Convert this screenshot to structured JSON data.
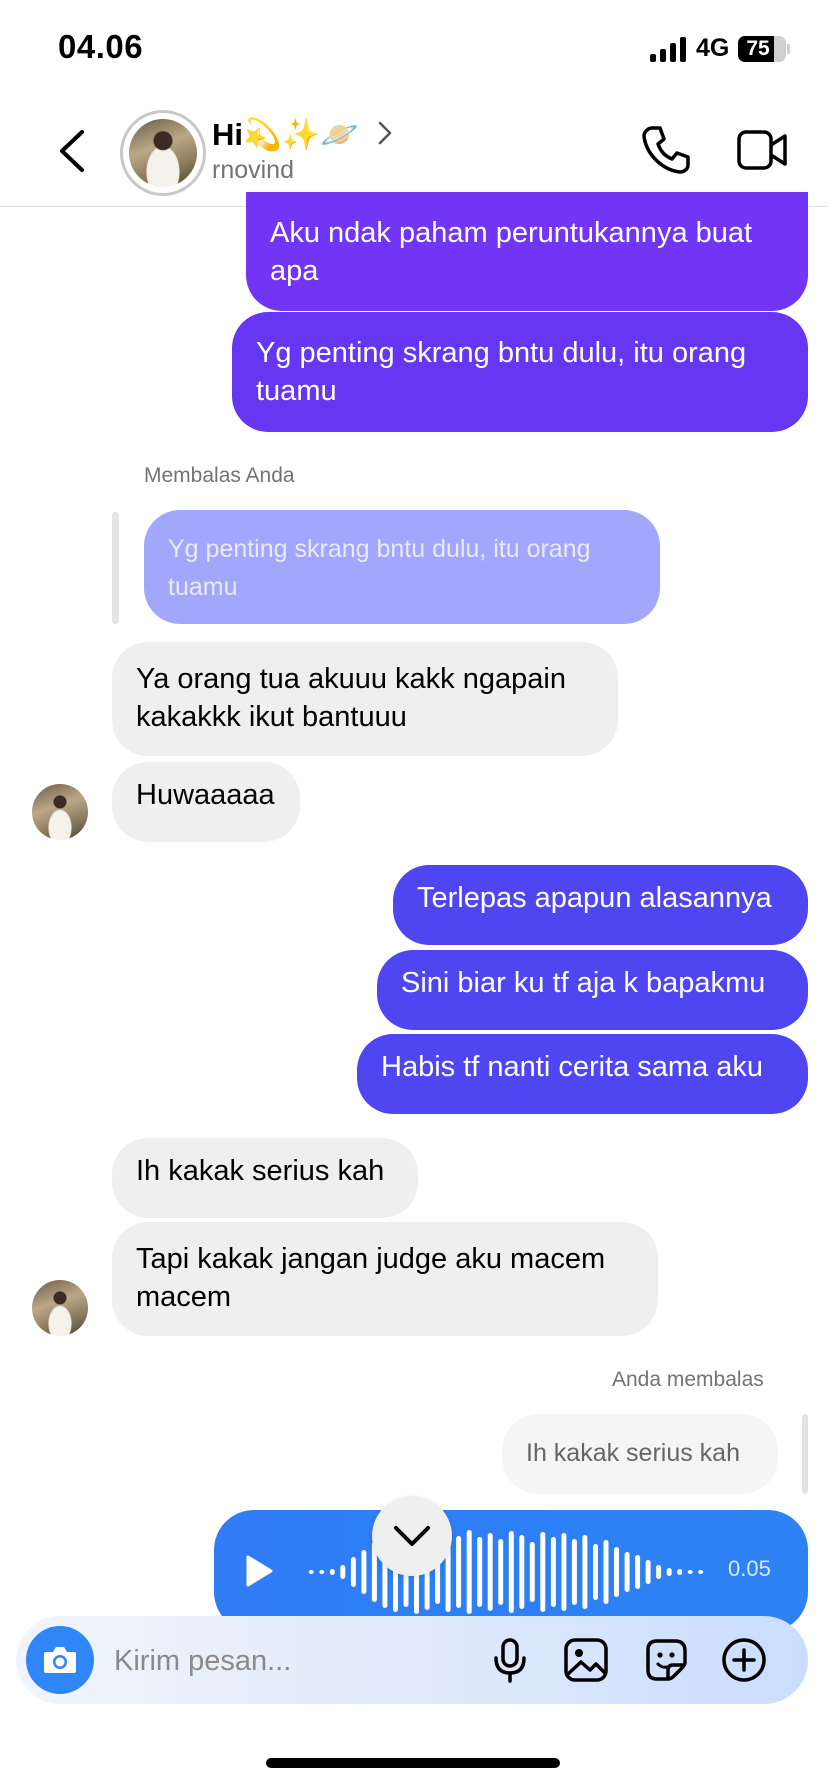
{
  "status_bar": {
    "time": "04.06",
    "network": "4G",
    "battery": "75",
    "battery_level": 0.75
  },
  "header": {
    "name": "Hi💫✨🪐",
    "username": "rnovind",
    "icons": {
      "back": "chevron-left-icon",
      "profile_chevron": "chevron-right-icon",
      "call": "phone-icon",
      "video": "video-camera-icon"
    }
  },
  "messages": {
    "m1": "Aku ndak paham peruntukannya buat apa",
    "m2": "Yg penting skrang bntu dulu, itu orang tuamu",
    "reply1_label": "Membalas Anda",
    "reply1_quote": "Yg penting skrang bntu dulu, itu orang tuamu",
    "m3": "Ya orang tua akuuu kakk ngapain kakakkk ikut bantuuu",
    "m4": "Huwaaaaa",
    "m5": "Terlepas apapun alasannya",
    "m6": "Sini biar ku tf aja k bapakmu",
    "m7": "Habis tf nanti cerita sama aku",
    "m8": "Ih kakak serius kah",
    "m9": "Tapi kakak jangan judge aku macem macem",
    "reply2_label": "Anda membalas",
    "reply2_quote": "Ih kakak serius kah"
  },
  "voice_message": {
    "duration": "0.05",
    "icon": "play-icon"
  },
  "composer": {
    "placeholder": "Kirim pesan...",
    "icons": [
      "camera-icon",
      "microphone-icon",
      "image-icon",
      "sticker-icon",
      "plus-circle-icon"
    ]
  },
  "colors": {
    "purple_dark": "#7234f5",
    "purple": "#6636f3",
    "blue_purple": "#4f45f1",
    "blue": "#2f86f6",
    "incoming": "#efefef",
    "quoted_out": "#a3a7fb"
  }
}
